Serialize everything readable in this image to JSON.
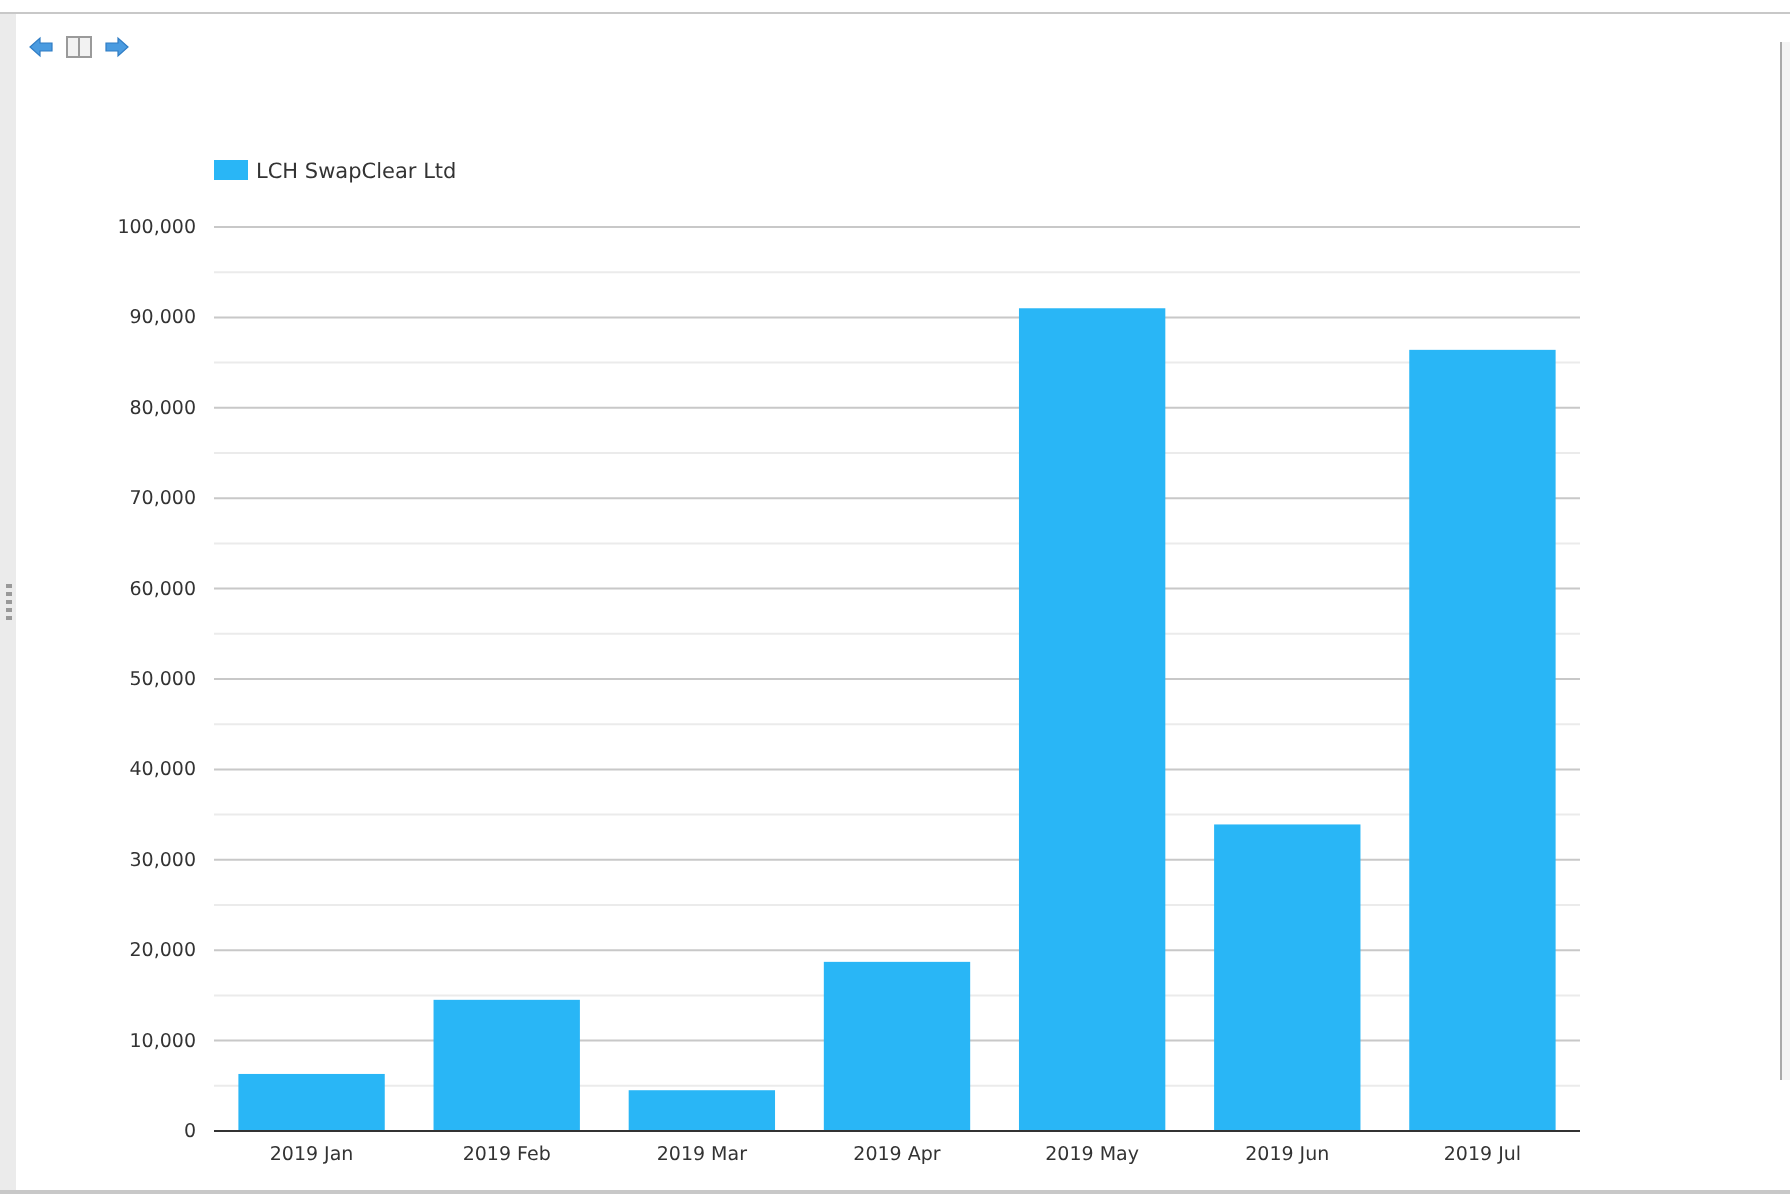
{
  "toolbar": {
    "buttons": [
      {
        "kind": "back"
      },
      {
        "kind": "panel"
      },
      {
        "kind": "forward"
      }
    ]
  },
  "chart": {
    "chart_data": {
      "type": "bar",
      "categories": [
        "2019 Jan",
        "2019 Feb",
        "2019 Mar",
        "2019 Apr",
        "2019 May",
        "2019 Jun",
        "2019 Jul"
      ],
      "series": [
        {
          "name": "LCH SwapClear Ltd",
          "color": "#29b6f6",
          "values": [
            6200,
            14400,
            4400,
            18600,
            90900,
            33800,
            86300
          ]
        }
      ],
      "ylim": [
        0,
        100000
      ],
      "grid": true,
      "yticks": [
        {
          "value": 0,
          "label": "0"
        },
        {
          "value": 10000,
          "label": "10,000"
        },
        {
          "value": 20000,
          "label": "20,000"
        },
        {
          "value": 30000,
          "label": "30,000"
        },
        {
          "value": 40000,
          "label": "40,000"
        },
        {
          "value": 50000,
          "label": "50,000"
        },
        {
          "value": 60000,
          "label": "60,000"
        },
        {
          "value": 70000,
          "label": "70,000"
        },
        {
          "value": 80000,
          "label": "80,000"
        },
        {
          "value": 90000,
          "label": "90,000"
        },
        {
          "value": 100000,
          "label": "100,000"
        }
      ]
    }
  }
}
